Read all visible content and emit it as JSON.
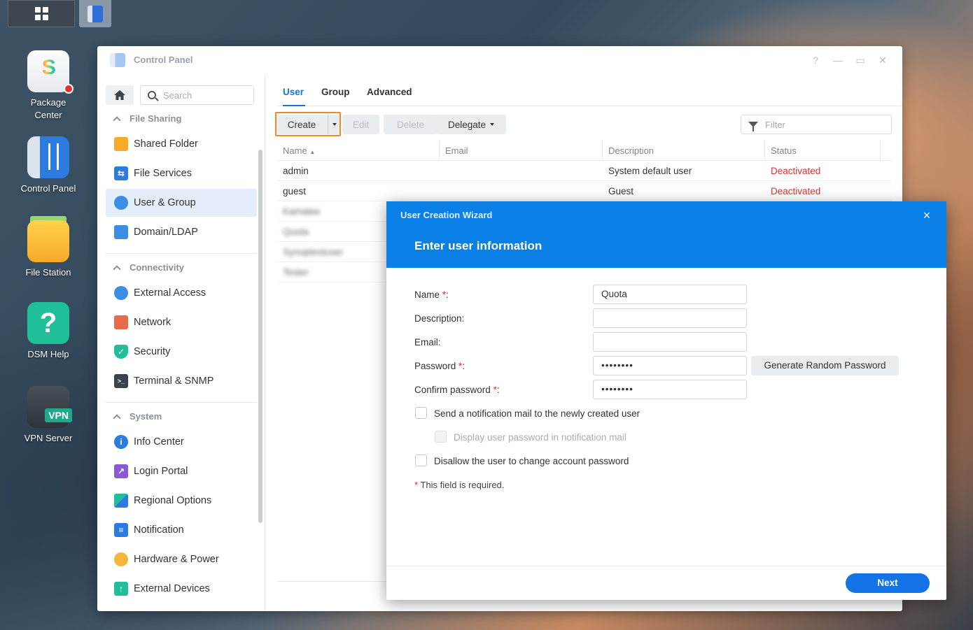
{
  "taskbar": {
    "main_menu": "main-menu",
    "active_app": "control-panel"
  },
  "desktop": {
    "icons": [
      {
        "label": "Package Center"
      },
      {
        "label": "Control Panel"
      },
      {
        "label": "File Station"
      },
      {
        "label": "DSM Help"
      },
      {
        "label": "VPN Server",
        "badge": "VPN"
      }
    ]
  },
  "window": {
    "title": "Control Panel",
    "controls": {
      "help": "?",
      "minimize": "—",
      "maximize": "▭",
      "close": "✕"
    }
  },
  "sidebar": {
    "search_placeholder": "Search",
    "sections": [
      {
        "title": "File Sharing",
        "items": [
          "Shared Folder",
          "File Services",
          "User & Group",
          "Domain/LDAP"
        ]
      },
      {
        "title": "Connectivity",
        "items": [
          "External Access",
          "Network",
          "Security",
          "Terminal & SNMP"
        ]
      },
      {
        "title": "System",
        "items": [
          "Info Center",
          "Login Portal",
          "Regional Options",
          "Notification",
          "Hardware & Power",
          "External Devices"
        ]
      }
    ],
    "active_item": "User & Group"
  },
  "tabs": [
    {
      "label": "User"
    },
    {
      "label": "Group"
    },
    {
      "label": "Advanced"
    }
  ],
  "active_tab": "User",
  "toolbar": {
    "create": "Create",
    "edit": "Edit",
    "delete": "Delete",
    "delegate": "Delegate",
    "filter_placeholder": "Filter"
  },
  "user_table": {
    "columns": [
      "Name",
      "Email",
      "Description",
      "Status"
    ],
    "sort": "Name ascending",
    "rows": [
      {
        "name": "admin",
        "email": "",
        "description": "System default user",
        "status": "Deactivated"
      },
      {
        "name": "guest",
        "email": "",
        "description": "Guest",
        "status": "Deactivated"
      },
      {
        "name": "Kamalee",
        "email": "",
        "description": "",
        "status": ""
      },
      {
        "name": "Quota",
        "email": "",
        "description": "",
        "status": ""
      },
      {
        "name": "Synoptestuser",
        "email": "",
        "description": "",
        "status": ""
      },
      {
        "name": "Tester",
        "email": "",
        "description": "",
        "status": ""
      }
    ]
  },
  "wizard": {
    "title": "User Creation Wizard",
    "close": "×",
    "step_title": "Enter user information",
    "fields": {
      "name_label": "Name",
      "name_value": "Quota",
      "description_label": "Description:",
      "description_value": "",
      "email_label": "Email:",
      "email_value": "",
      "password_label": "Password",
      "password_value": "••••••••",
      "confirm_label": "Confirm password",
      "confirm_value": "••••••••"
    },
    "required_mark": "*",
    "field_suffix": ":",
    "generate_password": "Generate Random Password",
    "options": {
      "send_mail": "Send a notification mail to the newly created user",
      "display_password": "Display user password in notification mail",
      "disallow_change": "Disallow the user to change account password"
    },
    "required_note": "This field is required.",
    "next": "Next"
  }
}
